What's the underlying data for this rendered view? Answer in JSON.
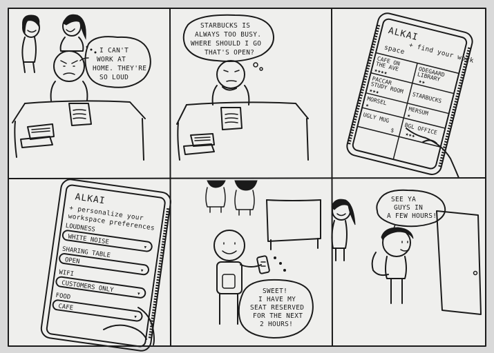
{
  "panel1": {
    "speech": [
      "I CAN'T",
      "WORK AT",
      "HOME. THEY'RE",
      "SO LOUD"
    ]
  },
  "panel2": {
    "speech": [
      "STARBUCKS IS",
      "ALWAYS TOO BUSY.",
      "WHERE SHOULD I GO",
      "THAT'S OPEN?"
    ]
  },
  "panel3": {
    "app_title": "ALKAI",
    "tagline": [
      "+ find your work",
      "space"
    ],
    "cells": [
      {
        "name": [
          "CAFE ON",
          "THE AVE"
        ],
        "stars": "★★★★"
      },
      {
        "name": [
          "ODEGAARD",
          "LIBRARY"
        ],
        "stars": "★★"
      },
      {
        "name": [
          "PACCAR",
          "STUDY ROOM"
        ],
        "stars": "★★★"
      },
      {
        "name": [
          "STARBUCKS"
        ],
        "stars": ""
      },
      {
        "name": [
          "MORSEL"
        ],
        "stars": "★"
      },
      {
        "name": [
          "MERSUM"
        ],
        "stars": "★"
      },
      {
        "name": [
          "UGLY MUG"
        ],
        "stars": "$"
      },
      {
        "name": [
          "BGL OFFICE"
        ],
        "stars": "★★★"
      }
    ]
  },
  "panel4": {
    "app_title": "ALKAI",
    "tagline": [
      "+ personalize your",
      "workspace preferences"
    ],
    "prefs": [
      {
        "label": "LOUDNESS",
        "value": "WHITE NOISE"
      },
      {
        "label": "SHARING TABLE",
        "value": "OPEN"
      },
      {
        "label": "WIFI",
        "value": "CUSTOMERS ONLY"
      },
      {
        "label": "FOOD",
        "value": "CAFE"
      }
    ]
  },
  "panel5": {
    "speech": [
      "SWEET!",
      "I HAVE MY",
      "SEAT RESERVED",
      "FOR THE NEXT",
      "2 HOURS!"
    ]
  },
  "panel6": {
    "speech": [
      "SEE YA",
      "GUYS IN",
      "A FEW HOURS!"
    ]
  }
}
